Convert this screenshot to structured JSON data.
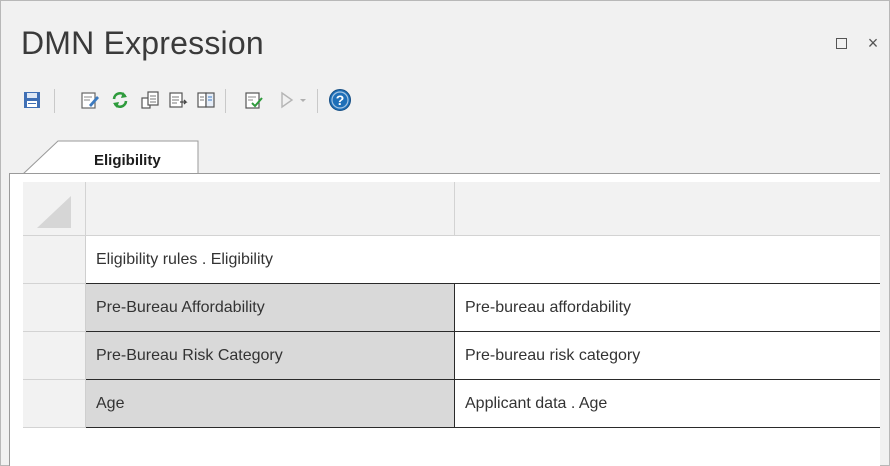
{
  "window": {
    "title": "DMN Expression",
    "restore_label": "",
    "close_label": "×"
  },
  "toolbar": {
    "buttons": [
      {
        "icon": "save-icon"
      },
      {
        "icon": "edit-icon"
      },
      {
        "icon": "refresh-icon"
      },
      {
        "icon": "paste-icon"
      },
      {
        "icon": "export-icon"
      },
      {
        "icon": "compare-icon"
      },
      {
        "icon": "validate-icon"
      },
      {
        "icon": "run-icon"
      },
      {
        "icon": "dropdown-arrow-icon"
      },
      {
        "icon": "help-icon"
      }
    ]
  },
  "tabs": [
    {
      "label": "Eligibility"
    }
  ],
  "table": {
    "header": [
      "",
      ""
    ],
    "title_row": "Eligibility rules . Eligibility",
    "rows": [
      {
        "label": "Pre-Bureau Affordability",
        "value": "Pre-bureau affordability"
      },
      {
        "label": "Pre-Bureau Risk Category",
        "value": "Pre-bureau risk category"
      },
      {
        "label": "Age",
        "value": "Applicant data . Age"
      }
    ]
  },
  "colors": {
    "window_bg": "#f1f1f1",
    "label_cell_bg": "#d9d9d9",
    "help_blue": "#1e6fb8",
    "refresh_green": "#2e9b3c"
  }
}
